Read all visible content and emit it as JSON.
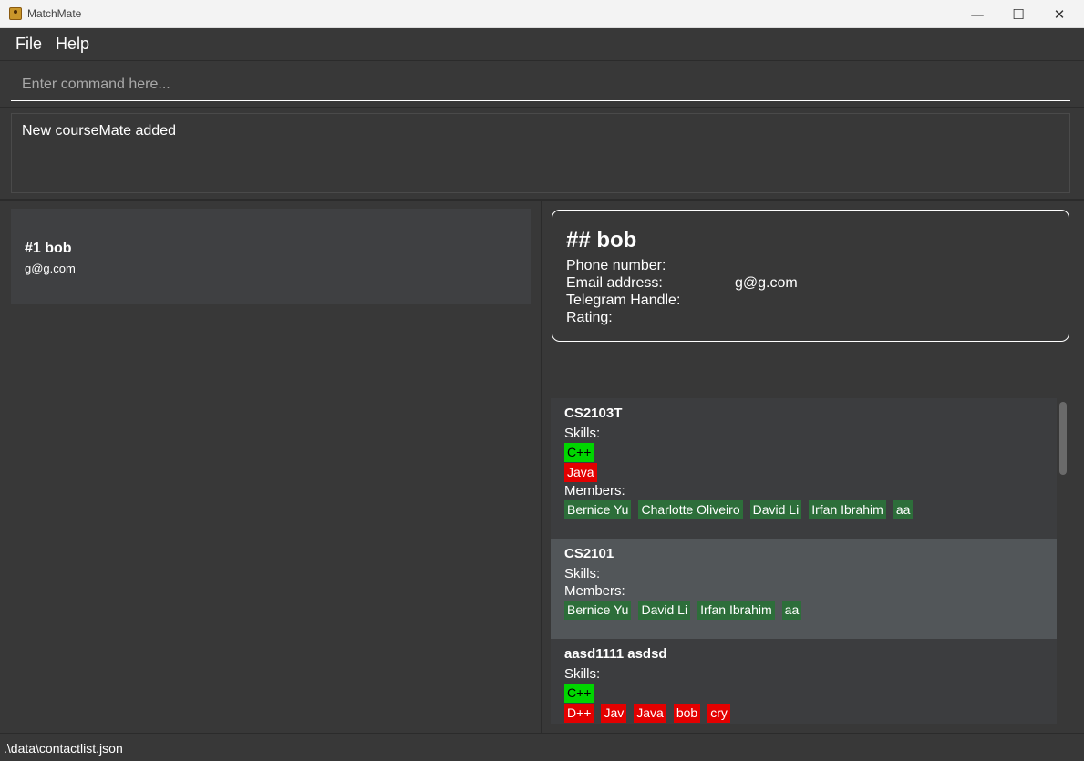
{
  "window": {
    "title": "MatchMate",
    "icons": {
      "app": "app-icon",
      "minimize": "minimize-icon",
      "maximize": "maximize-icon",
      "close": "close-icon"
    }
  },
  "menu": {
    "file": "File",
    "help": "Help"
  },
  "command": {
    "placeholder": "Enter command here...",
    "value": ""
  },
  "result": {
    "text": "New courseMate added"
  },
  "person_list": [
    {
      "name": "#1  bob",
      "email": "g@g.com"
    }
  ],
  "detail": {
    "name": "##  bob",
    "phone_label": "Phone number:",
    "phone_value": "",
    "email_label": "Email address:",
    "email_value": "g@g.com",
    "telegram_label": "Telegram Handle:",
    "telegram_value": "",
    "rating_label": "Rating:",
    "rating_value": ""
  },
  "groups": [
    {
      "title": "CS2103T",
      "skills_label": "Skills:",
      "skills_green": [
        "C++"
      ],
      "skills_red": [
        "Java"
      ],
      "members_label": "Members:",
      "members": [
        "Bernice Yu",
        "Charlotte Oliveiro",
        "David Li",
        "Irfan Ibrahim",
        "aa"
      ]
    },
    {
      "title": "CS2101",
      "skills_label": "Skills:",
      "skills_green": [],
      "skills_red": [],
      "members_label": "Members:",
      "members": [
        "Bernice Yu",
        "David Li",
        "Irfan Ibrahim",
        "aa"
      ]
    },
    {
      "title": "aasd1111 asdsd",
      "skills_label": "Skills:",
      "skills_green": [
        "C++"
      ],
      "skills_red": [
        "D++",
        "Jav",
        "Java",
        "bob",
        "cry"
      ],
      "members_label": "",
      "members": []
    }
  ],
  "colors": {
    "background": "#383838",
    "skill_green": "#00d600",
    "skill_red": "#e30000",
    "member_tag": "#2d6e3a"
  },
  "status": {
    "path": ".\\data\\contactlist.json"
  }
}
